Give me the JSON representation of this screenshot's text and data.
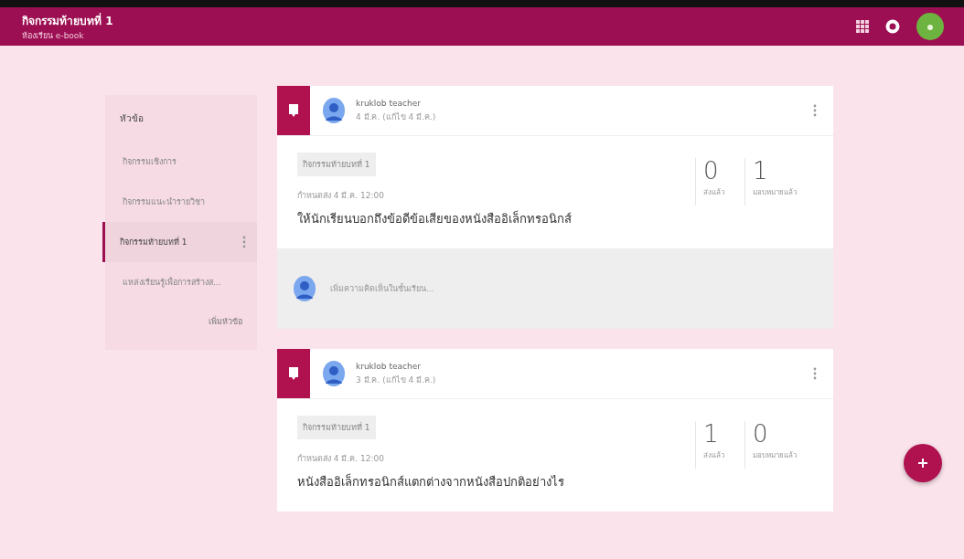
{
  "header": {
    "title": "กิจกรรมท้ายบทที่ 1",
    "subtitle": "ห้องเรียน e-book"
  },
  "sidebar": {
    "heading": "หัวข้อ",
    "items": [
      {
        "label": "กิจกรรมเชิงการ",
        "selected": false
      },
      {
        "label": "กิจกรรมแนะนำรายวิชา",
        "selected": false
      },
      {
        "label": "กิจกรรมท้ายบทที่ 1",
        "selected": true
      },
      {
        "label": "แหล่งเรียนรู้เพื่อการสร้างส...",
        "selected": false
      }
    ],
    "add_label": "เพิ่มหัวข้อ"
  },
  "posts": [
    {
      "author": "kruklob teacher",
      "date": "4 มี.ค. (แก้ไข 4 มี.ค.)",
      "topic": "กิจกรรมท้ายบทที่ 1",
      "due": "กำหนดส่ง 4 มี.ค. 12:00",
      "question": "ให้นักเรียนบอกถึงข้อดีข้อเสียของหนังสืออิเล็กทรอนิกส์",
      "stats": [
        {
          "value": "0",
          "label": "ส่งแล้ว"
        },
        {
          "value": "1",
          "label": "มอบหมายแล้ว"
        }
      ],
      "comment_placeholder": "เพิ่มความคิดเห็นในชั้นเรียน..."
    },
    {
      "author": "kruklob teacher",
      "date": "3 มี.ค. (แก้ไข 4 มี.ค.)",
      "topic": "กิจกรรมท้ายบทที่ 1",
      "due": "กำหนดส่ง 4 มี.ค. 12:00",
      "question": "หนังสืออิเล็กทรอนิกส์แตกต่างจากหนังสือปกติอย่างไร",
      "stats": [
        {
          "value": "1",
          "label": "ส่งแล้ว"
        },
        {
          "value": "0",
          "label": "มอบหมายแล้ว"
        }
      ]
    }
  ]
}
